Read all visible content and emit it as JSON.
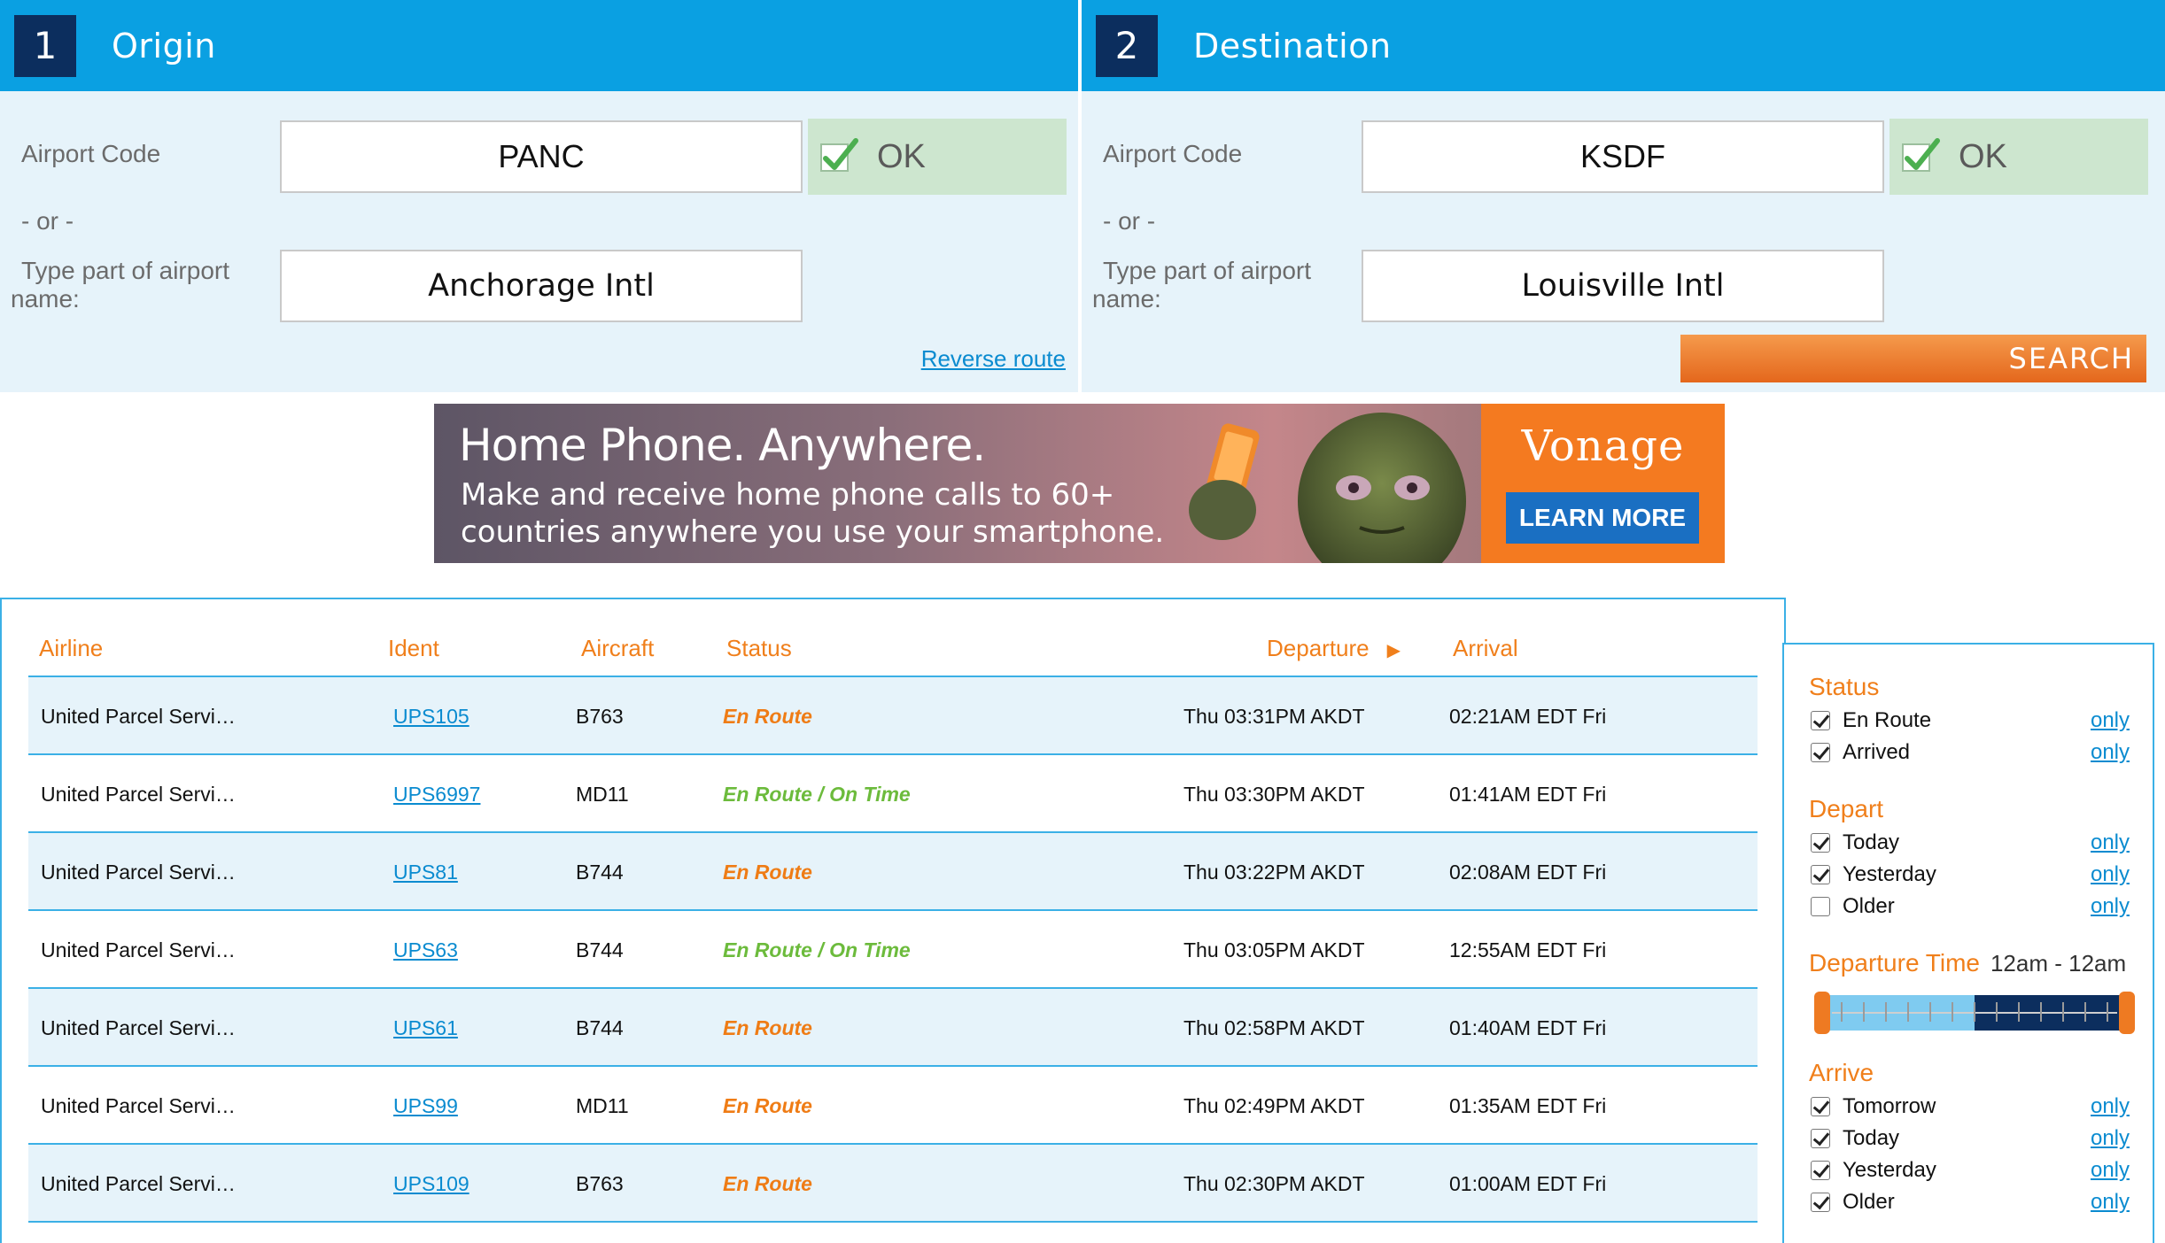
{
  "origin": {
    "step": "1",
    "title": "Origin",
    "code_label": "Airport Code",
    "code_value": "PANC",
    "ok_label": "OK",
    "or_label": "- or -",
    "name_label": "Type part of airport name:",
    "name_value": "Anchorage Intl",
    "reverse_link": "Reverse route"
  },
  "destination": {
    "step": "2",
    "title": "Destination",
    "code_label": "Airport Code",
    "code_value": "KSDF",
    "ok_label": "OK",
    "or_label": "- or -",
    "name_label": "Type part of airport name:",
    "name_value": "Louisville Intl",
    "search_button": "SEARCH"
  },
  "ad": {
    "headline": "Home Phone. Anywhere.",
    "subtext": "Make and receive home phone calls to 60+ countries anywhere you use your smartphone.",
    "brand": "Vonage",
    "cta": "LEARN MORE"
  },
  "table": {
    "headers": {
      "airline": "Airline",
      "ident": "Ident",
      "aircraft": "Aircraft",
      "status": "Status",
      "departure": "Departure",
      "arrival": "Arrival"
    },
    "rows": [
      {
        "airline": "United Parcel Servi…",
        "ident": "UPS105",
        "aircraft": "B763",
        "status": "En Route",
        "departure": "Thu 03:31PM AKDT",
        "arrival": "02:21AM EDT Fri"
      },
      {
        "airline": "United Parcel Servi…",
        "ident": "UPS6997",
        "aircraft": "MD11",
        "status": "En Route / On Time",
        "departure": "Thu 03:30PM AKDT",
        "arrival": "01:41AM EDT Fri"
      },
      {
        "airline": "United Parcel Servi…",
        "ident": "UPS81",
        "aircraft": "B744",
        "status": "En Route",
        "departure": "Thu 03:22PM AKDT",
        "arrival": "02:08AM EDT Fri"
      },
      {
        "airline": "United Parcel Servi…",
        "ident": "UPS63",
        "aircraft": "B744",
        "status": "En Route / On Time",
        "departure": "Thu 03:05PM AKDT",
        "arrival": "12:55AM EDT Fri"
      },
      {
        "airline": "United Parcel Servi…",
        "ident": "UPS61",
        "aircraft": "B744",
        "status": "En Route",
        "departure": "Thu 02:58PM AKDT",
        "arrival": "01:40AM EDT Fri"
      },
      {
        "airline": "United Parcel Servi…",
        "ident": "UPS99",
        "aircraft": "MD11",
        "status": "En Route",
        "departure": "Thu 02:49PM AKDT",
        "arrival": "01:35AM EDT Fri"
      },
      {
        "airline": "United Parcel Servi…",
        "ident": "UPS109",
        "aircraft": "B763",
        "status": "En Route",
        "departure": "Thu 02:30PM AKDT",
        "arrival": "01:00AM EDT Fri"
      }
    ]
  },
  "filters": {
    "only_label": "only",
    "status": {
      "title": "Status",
      "items": [
        {
          "label": "En Route",
          "checked": true
        },
        {
          "label": "Arrived",
          "checked": true
        }
      ]
    },
    "depart": {
      "title": "Depart",
      "items": [
        {
          "label": "Today",
          "checked": true
        },
        {
          "label": "Yesterday",
          "checked": true
        },
        {
          "label": "Older",
          "checked": false
        }
      ]
    },
    "departure_time": {
      "title": "Departure Time",
      "range": "12am - 12am"
    },
    "arrive": {
      "title": "Arrive",
      "items": [
        {
          "label": "Tomorrow",
          "checked": true
        },
        {
          "label": "Today",
          "checked": true
        },
        {
          "label": "Yesterday",
          "checked": true
        },
        {
          "label": "Older",
          "checked": true
        }
      ]
    }
  },
  "colors": {
    "header_blue": "#0aa0e2",
    "panel_bg": "#e6f3fa",
    "accent_orange": "#f07f1b",
    "link_blue": "#0a8bd0",
    "on_time_green": "#6cbb3c",
    "ok_green_bg": "#cde6cf"
  },
  "icons": [
    "check-icon",
    "sort-arrow-icon",
    "checkbox-icon",
    "slider-handle-icon"
  ]
}
